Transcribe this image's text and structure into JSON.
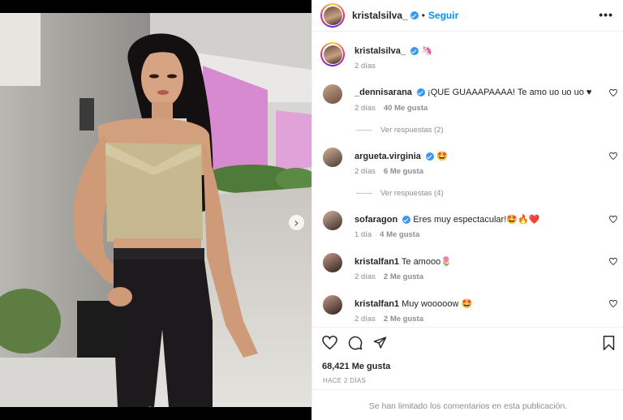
{
  "post": {
    "author": "kristalsilva_",
    "follow_label": "Seguir",
    "separator": "•",
    "more_label": "•••",
    "caption_emoji": "🦄",
    "caption_time": "2 días",
    "carousel_next": "›"
  },
  "comments": [
    {
      "user": "_dennisarana",
      "verified": true,
      "text": "¡QUE GUAAAPAAAA! Te amo uo uo uo ♥",
      "time": "2 días",
      "likes": "40 Me gusta",
      "replies": "Ver respuestas (2)"
    },
    {
      "user": "argueta.virginia",
      "verified": true,
      "text": "🤩",
      "time": "2 días",
      "likes": "6 Me gusta",
      "replies": "Ver respuestas (4)"
    },
    {
      "user": "sofaragon",
      "verified": true,
      "text": "Eres muy espectacular!🤩🔥❤️",
      "time": "1 día",
      "likes": "4 Me gusta"
    },
    {
      "user": "kristalfan1",
      "verified": false,
      "text": "Te amooo🌷",
      "time": "2 días",
      "likes": "2 Me gusta"
    },
    {
      "user": "kristalfan1",
      "verified": false,
      "text": "Muy wooooow 🤩",
      "time": "2 días",
      "likes": "2 Me gusta"
    }
  ],
  "footer": {
    "likes_count": "68,421 Me gusta",
    "posted_ago": "HACE 2 DÍAS",
    "comments_limited": "Se han limitado los comentarios en esta publicación."
  },
  "icons": [
    "heart-icon",
    "comment-icon",
    "share-icon",
    "bookmark-icon",
    "chevron-right-icon",
    "verified-icon"
  ],
  "colors": {
    "accent": "#0095f6",
    "verified": "#3897f0",
    "text": "#262626",
    "muted": "#8e8e8e"
  }
}
